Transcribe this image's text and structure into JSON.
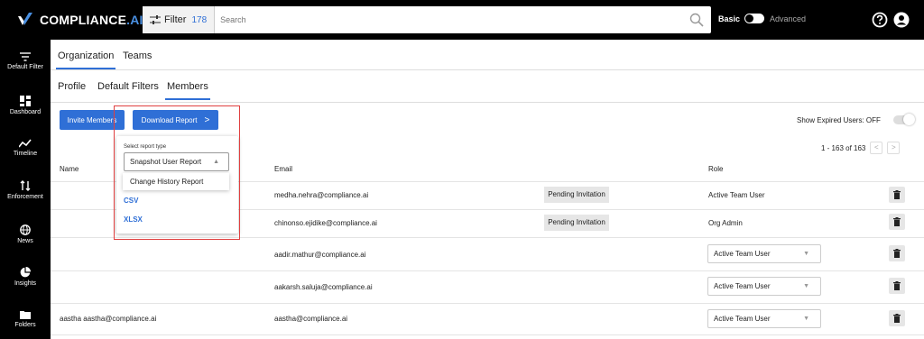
{
  "app": {
    "brand_prefix": "COMPLIANCE",
    "brand_suffix": ".AI"
  },
  "colors": {
    "accent": "#2f6fd6",
    "topbar": "#000000",
    "highlight_box": "#e04040"
  },
  "search": {
    "filter_label": "Filter",
    "filter_count": "178",
    "placeholder": "Search"
  },
  "mode": {
    "basic": "Basic",
    "advanced": "Advanced"
  },
  "sidebar": {
    "items": [
      {
        "label": "Default Filter",
        "icon": "filter-icon"
      },
      {
        "label": "Dashboard",
        "icon": "dashboard-icon"
      },
      {
        "label": "Timeline",
        "icon": "timeline-icon"
      },
      {
        "label": "Enforcement",
        "icon": "enforcement-icon"
      },
      {
        "label": "News",
        "icon": "globe-icon"
      },
      {
        "label": "Insights",
        "icon": "pie-chart-icon"
      },
      {
        "label": "Folders",
        "icon": "folder-icon"
      }
    ]
  },
  "tabs_primary": [
    "Organization",
    "Teams"
  ],
  "tabs_secondary": [
    "Profile",
    "Default Filters",
    "Members"
  ],
  "actions": {
    "invite": "Invite Members",
    "download": "Download Report",
    "download_chevron": ">"
  },
  "expired": {
    "label": "Show Expired Users: OFF"
  },
  "pager": {
    "text": "1 - 163 of 163",
    "prev": "<",
    "next": ">"
  },
  "table": {
    "headers": {
      "name": "Name",
      "email": "Email",
      "role": "Role"
    },
    "rows": [
      {
        "name": "",
        "email": "medha.nehra@compliance.ai",
        "status": "Pending Invitation",
        "role": "Active Team User"
      },
      {
        "name": "",
        "email": "chinonso.ejidike@compliance.ai",
        "status": "Pending Invitation",
        "role": "Org Admin"
      },
      {
        "name": "",
        "email": "aadir.mathur@compliance.ai",
        "status": "",
        "role": "Active Team User"
      },
      {
        "name": "",
        "email": "aakarsh.saluja@compliance.ai",
        "status": "",
        "role": "Active Team User"
      },
      {
        "name": "aastha aastha@compliance.ai",
        "email": "aastha@compliance.ai",
        "status": "",
        "role": "Active Team User"
      }
    ]
  },
  "report_dropdown": {
    "label": "Select report type",
    "selected": "Snapshot User Report",
    "option": "Change History Report",
    "formats": [
      "CSV",
      "XLSX"
    ]
  }
}
